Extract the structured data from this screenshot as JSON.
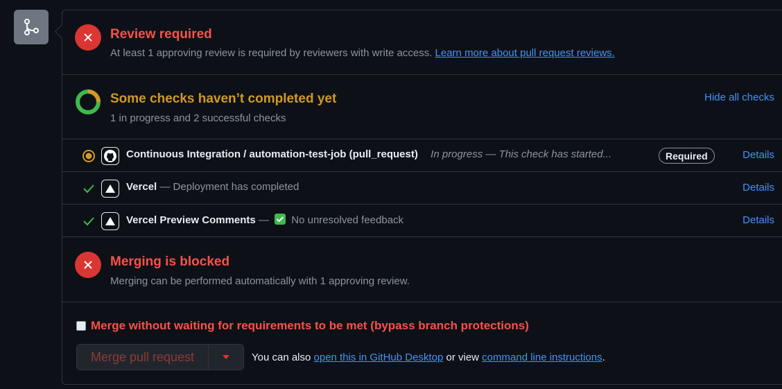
{
  "review": {
    "title": "Review required",
    "subtitle": "At least 1 approving review is required by reviewers with write access.",
    "link": "Learn more about pull request reviews."
  },
  "checks": {
    "title": "Some checks haven’t completed yet",
    "subtitle": "1 in progress and 2 successful checks",
    "hide_label": "Hide all checks",
    "items": [
      {
        "name": "Continuous Integration / automation-test-job (pull_request)",
        "description": "In progress — This check has started...",
        "badge": "Required",
        "details": "Details",
        "state": "in-progress"
      },
      {
        "name": "Vercel",
        "description": "— Deployment has completed",
        "details": "Details",
        "state": "success"
      },
      {
        "name": "Vercel Preview Comments",
        "description_prefix": "—",
        "description": "No unresolved feedback",
        "details": "Details",
        "state": "success"
      }
    ]
  },
  "merge_block": {
    "title": "Merging is blocked",
    "subtitle": "Merging can be performed automatically with 1 approving review."
  },
  "bypass": {
    "label": "Merge without waiting for requirements to be met (bypass branch protections)"
  },
  "merge": {
    "button_label": "Merge pull request",
    "note_prefix": "You can also",
    "desktop_link": "open this in GitHub Desktop",
    "note_middle": "or view",
    "cli_link": "command line instructions",
    "note_suffix": "."
  },
  "colors": {
    "error": "#f85149",
    "warning": "#d29922",
    "success": "#3fb950",
    "link": "#4493f8"
  }
}
